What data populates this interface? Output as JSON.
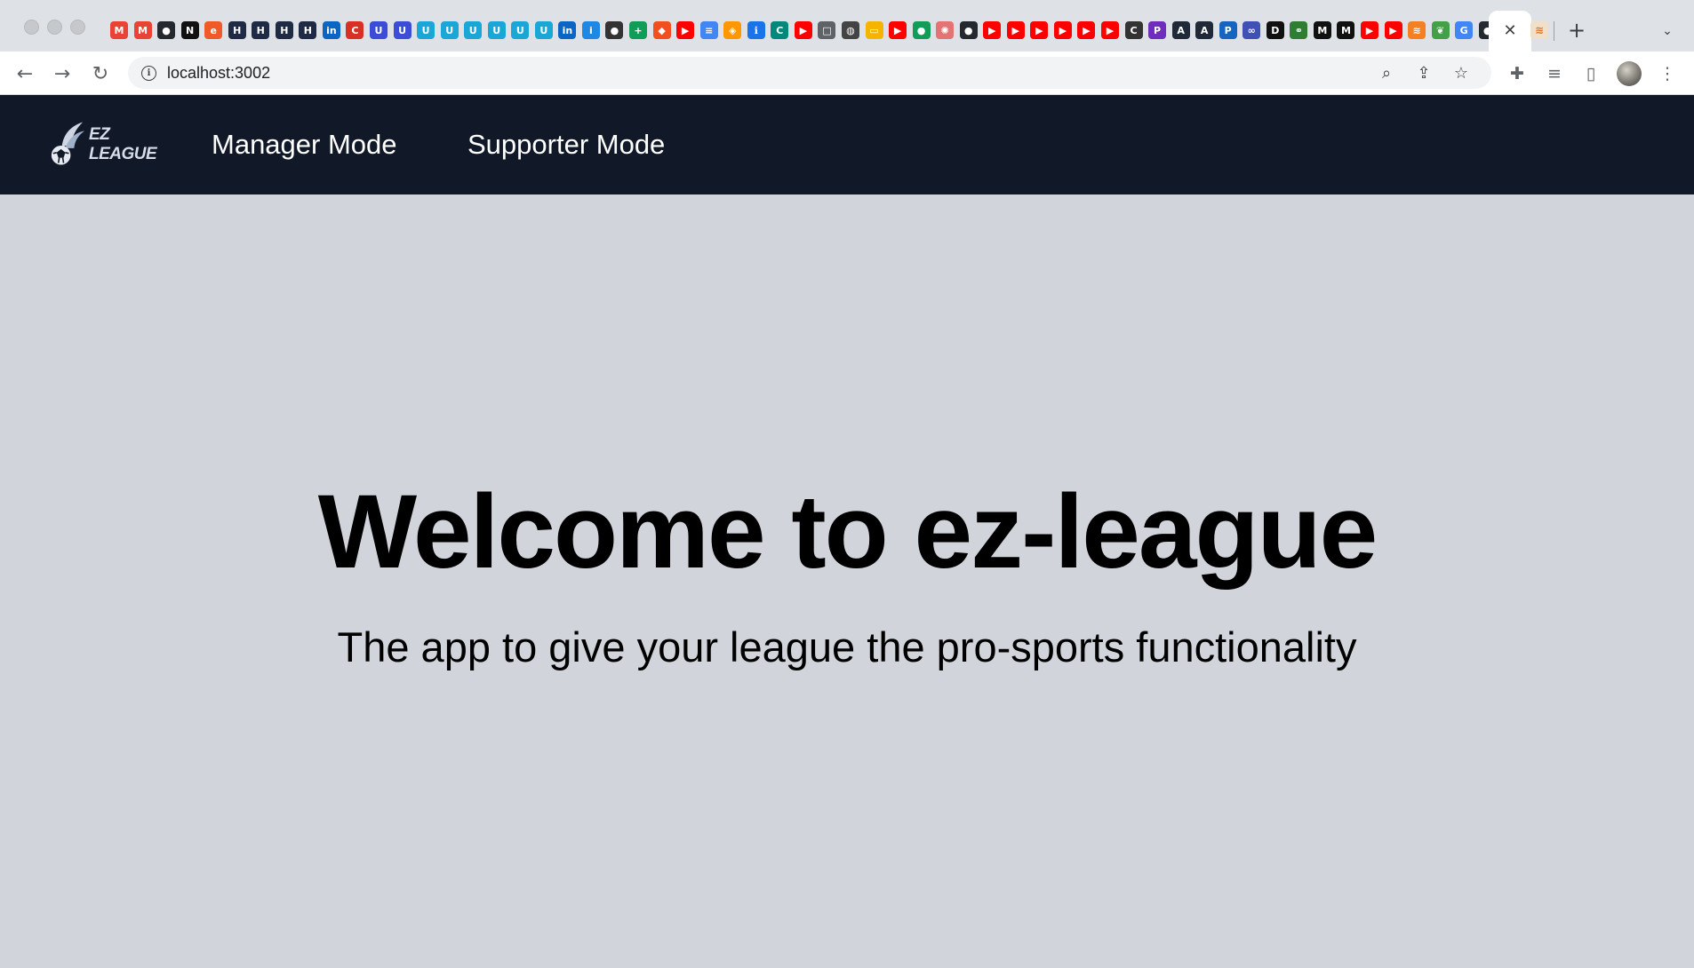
{
  "browser": {
    "url": "localhost:3002",
    "bookmark_favicons": [
      {
        "icon": "gmail-icon",
        "color": "#ea4335",
        "glyph": "M"
      },
      {
        "icon": "gmail-icon",
        "color": "#ea4335",
        "glyph": "M"
      },
      {
        "icon": "github-icon",
        "color": "#24292f",
        "glyph": "●"
      },
      {
        "icon": "notion-icon",
        "color": "#111111",
        "glyph": "N"
      },
      {
        "icon": "e-icon",
        "color": "#f05a28",
        "glyph": "e"
      },
      {
        "icon": "h-icon",
        "color": "#1f2a44",
        "glyph": "H"
      },
      {
        "icon": "h-icon",
        "color": "#1f2a44",
        "glyph": "H"
      },
      {
        "icon": "h-icon",
        "color": "#1f2a44",
        "glyph": "H"
      },
      {
        "icon": "h-icon",
        "color": "#1f2a44",
        "glyph": "H"
      },
      {
        "icon": "linkedin-icon",
        "color": "#0a66c2",
        "glyph": "in"
      },
      {
        "icon": "cc-icon",
        "color": "#d93025",
        "glyph": "C"
      },
      {
        "icon": "u-icon",
        "color": "#3b4cd6",
        "glyph": "U"
      },
      {
        "icon": "u-icon",
        "color": "#3b4cd6",
        "glyph": "U"
      },
      {
        "icon": "u-icon",
        "color": "#19a7d8",
        "glyph": "U"
      },
      {
        "icon": "u-icon",
        "color": "#19a7d8",
        "glyph": "U"
      },
      {
        "icon": "u-icon",
        "color": "#19a7d8",
        "glyph": "U"
      },
      {
        "icon": "u-icon",
        "color": "#19a7d8",
        "glyph": "U"
      },
      {
        "icon": "u-icon",
        "color": "#19a7d8",
        "glyph": "U"
      },
      {
        "icon": "u-icon",
        "color": "#19a7d8",
        "glyph": "U"
      },
      {
        "icon": "linkedin-icon",
        "color": "#0a66c2",
        "glyph": "in"
      },
      {
        "icon": "info-icon",
        "color": "#1e88e5",
        "glyph": "i"
      },
      {
        "icon": "circle-icon",
        "color": "#333333",
        "glyph": "●"
      },
      {
        "icon": "plus-icon",
        "color": "#0f9d58",
        "glyph": "+"
      },
      {
        "icon": "figma-icon",
        "color": "#f24e1e",
        "glyph": "◆"
      },
      {
        "icon": "youtube-icon",
        "color": "#ff0000",
        "glyph": "▶"
      },
      {
        "icon": "docs-icon",
        "color": "#4285f4",
        "glyph": "≡"
      },
      {
        "icon": "layers-icon",
        "color": "#ff9800",
        "glyph": "◈"
      },
      {
        "icon": "info-icon",
        "color": "#1a73e8",
        "glyph": "ℹ"
      },
      {
        "icon": "c-icon",
        "color": "#00897b",
        "glyph": "C"
      },
      {
        "icon": "youtube-icon",
        "color": "#ff0000",
        "glyph": "▶"
      },
      {
        "icon": "square-icon",
        "color": "#5f6368",
        "glyph": "□"
      },
      {
        "icon": "globe-icon",
        "color": "#444444",
        "glyph": "◍"
      },
      {
        "icon": "slides-icon",
        "color": "#f4b400",
        "glyph": "▭"
      },
      {
        "icon": "youtube-icon",
        "color": "#ff0000",
        "glyph": "▶"
      },
      {
        "icon": "green-circle-icon",
        "color": "#0f9d58",
        "glyph": "●"
      },
      {
        "icon": "openai-icon",
        "color": "#e57373",
        "glyph": "✺"
      },
      {
        "icon": "github-icon",
        "color": "#24292f",
        "glyph": "●"
      },
      {
        "icon": "youtube-icon",
        "color": "#ff0000",
        "glyph": "▶"
      },
      {
        "icon": "youtube-icon",
        "color": "#ff0000",
        "glyph": "▶"
      },
      {
        "icon": "youtube-icon",
        "color": "#ff0000",
        "glyph": "▶"
      },
      {
        "icon": "youtube-icon",
        "color": "#ff0000",
        "glyph": "▶"
      },
      {
        "icon": "youtube-icon",
        "color": "#ff0000",
        "glyph": "▶"
      },
      {
        "icon": "youtube-icon",
        "color": "#ff0000",
        "glyph": "▶"
      },
      {
        "icon": "c-icon",
        "color": "#333333",
        "glyph": "C"
      },
      {
        "icon": "p-icon",
        "color": "#6f2dbd",
        "glyph": "P"
      },
      {
        "icon": "a-icon",
        "color": "#1f2937",
        "glyph": "A"
      },
      {
        "icon": "a-icon",
        "color": "#1f2937",
        "glyph": "A"
      },
      {
        "icon": "p-icon",
        "color": "#1565c0",
        "glyph": "P"
      },
      {
        "icon": "infinity-icon",
        "color": "#3f51b5",
        "glyph": "∞"
      },
      {
        "icon": "dev-icon",
        "color": "#111111",
        "glyph": "D"
      },
      {
        "icon": "link-icon",
        "color": "#2e7d32",
        "glyph": "⚭"
      },
      {
        "icon": "m-icon",
        "color": "#111111",
        "glyph": "M"
      },
      {
        "icon": "m-icon",
        "color": "#111111",
        "glyph": "M"
      },
      {
        "icon": "youtube-icon",
        "color": "#ff0000",
        "glyph": "▶"
      },
      {
        "icon": "youtube-icon",
        "color": "#ff0000",
        "glyph": "▶"
      },
      {
        "icon": "stackoverflow-icon",
        "color": "#f48024",
        "glyph": "≋"
      },
      {
        "icon": "leaf-icon",
        "color": "#43a047",
        "glyph": "❦"
      },
      {
        "icon": "google-icon",
        "color": "#4285f4",
        "glyph": "G"
      },
      {
        "icon": "github-icon",
        "color": "#24292f",
        "glyph": "●"
      }
    ]
  },
  "app": {
    "logo_text": "EZ LEAGUE",
    "nav": {
      "manager": "Manager Mode",
      "supporter": "Supporter Mode"
    },
    "hero": {
      "title": "Welcome to ez-league",
      "subtitle": "The app to give your league the pro-sports functionality"
    },
    "colors": {
      "navbar_bg": "#111827",
      "page_bg": "#d1d5db"
    }
  }
}
